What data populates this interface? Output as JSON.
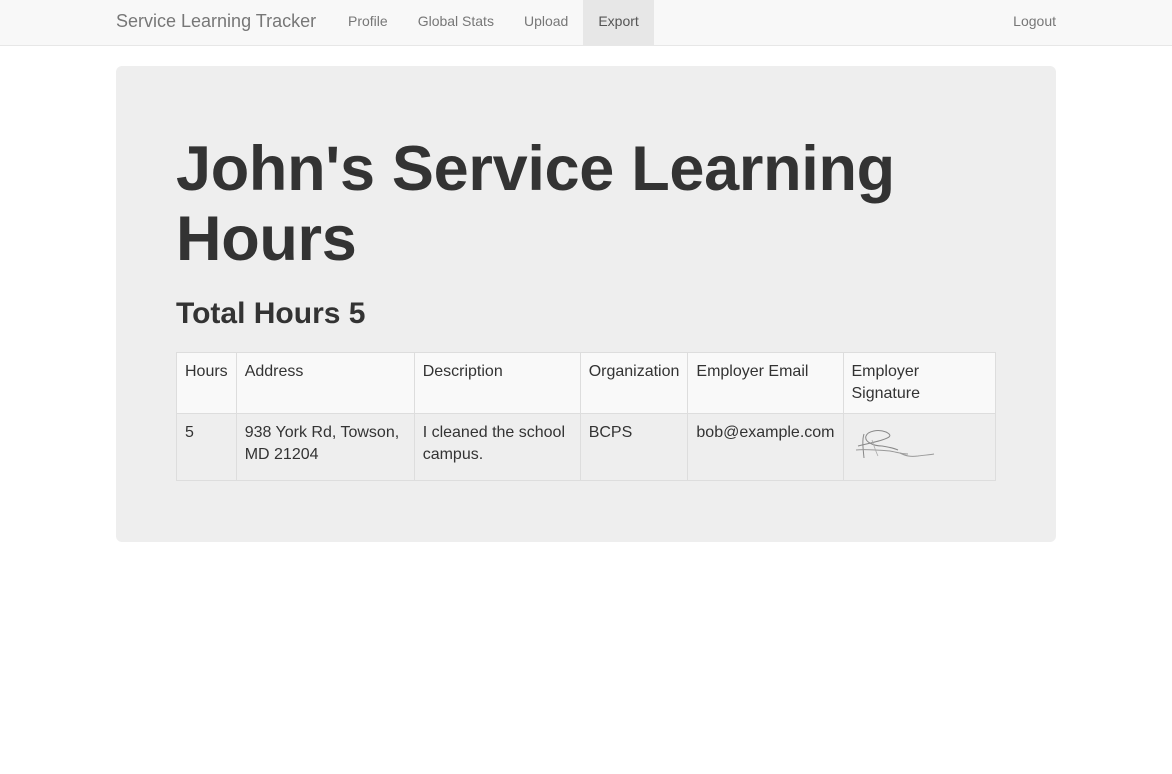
{
  "navbar": {
    "brand": "Service Learning Tracker",
    "items": [
      {
        "label": "Profile"
      },
      {
        "label": "Global Stats"
      },
      {
        "label": "Upload"
      },
      {
        "label": "Export",
        "active": true
      }
    ],
    "logout": "Logout"
  },
  "main": {
    "title_line1": "John's Service Learning",
    "title_line2": "Hours",
    "total_label": "Total Hours 5"
  },
  "table": {
    "headers": [
      "Hours",
      "Address",
      "Description",
      "Organization",
      "Employer Email",
      "Employer",
      "Signature"
    ],
    "rows": [
      {
        "hours": "5",
        "address_line1": "938 York Rd, Towson,",
        "address_line2": "MD 21204",
        "description_line1": "I cleaned the school",
        "description_line2": "campus.",
        "organization": "BCPS",
        "email": "bob@example.com"
      }
    ]
  },
  "colors": {
    "navbar_bg": "#f8f8f8",
    "active_tab_bg": "#e7e7e7",
    "jumbotron_bg": "#eeeeee",
    "text": "#333333",
    "nav_text": "#777777"
  }
}
